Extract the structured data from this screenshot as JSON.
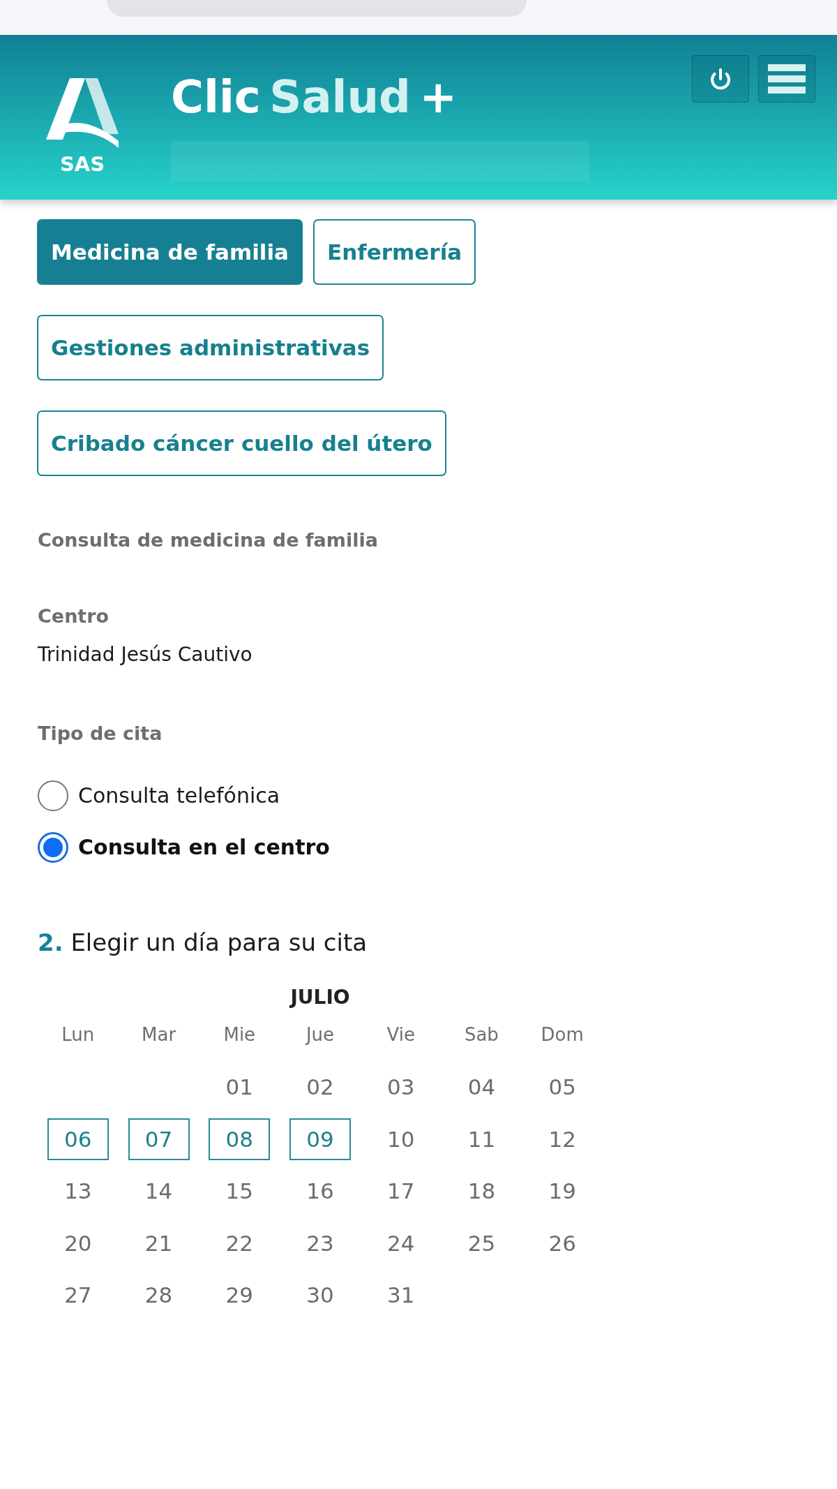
{
  "header": {
    "logo_text": "SAS",
    "title_parts": [
      "Clic",
      "Salud",
      "+"
    ]
  },
  "tabs": [
    {
      "label": "Medicina de familia",
      "selected": true
    },
    {
      "label": "Enfermería",
      "selected": false
    },
    {
      "label": "Gestiones administrativas",
      "selected": false
    },
    {
      "label": "Cribado cáncer cuello del útero",
      "selected": false
    }
  ],
  "section_title": "Consulta de medicina de familia",
  "centro": {
    "label": "Centro",
    "value": "Trinidad Jesús Cautivo"
  },
  "tipo_de_cita": {
    "label": "Tipo de cita",
    "options": [
      {
        "label": "Consulta telefónica",
        "selected": false
      },
      {
        "label": "Consulta en el centro",
        "selected": true
      }
    ]
  },
  "step": {
    "number": "2.",
    "title": "Elegir un día para su cita"
  },
  "calendar": {
    "month": "JULIO",
    "weekdays": [
      "Lun",
      "Mar",
      "Mie",
      "Jue",
      "Vie",
      "Sab",
      "Dom"
    ],
    "weeks": [
      [
        {
          "kind": "blank"
        },
        {
          "kind": "blank"
        },
        {
          "kind": "day",
          "day": "01",
          "available": false
        },
        {
          "kind": "day",
          "day": "02",
          "available": false
        },
        {
          "kind": "day",
          "day": "03",
          "available": false
        },
        {
          "kind": "day",
          "day": "04",
          "available": false
        },
        {
          "kind": "day",
          "day": "05",
          "available": false
        }
      ],
      [
        {
          "kind": "day",
          "day": "06",
          "available": true
        },
        {
          "kind": "day",
          "day": "07",
          "available": true
        },
        {
          "kind": "day",
          "day": "08",
          "available": true
        },
        {
          "kind": "day",
          "day": "09",
          "available": true
        },
        {
          "kind": "day",
          "day": "10",
          "available": false
        },
        {
          "kind": "day",
          "day": "11",
          "available": false
        },
        {
          "kind": "day",
          "day": "12",
          "available": false
        }
      ],
      [
        {
          "kind": "day",
          "day": "13",
          "available": false
        },
        {
          "kind": "day",
          "day": "14",
          "available": false
        },
        {
          "kind": "day",
          "day": "15",
          "available": false
        },
        {
          "kind": "day",
          "day": "16",
          "available": false
        },
        {
          "kind": "day",
          "day": "17",
          "available": false
        },
        {
          "kind": "day",
          "day": "18",
          "available": false
        },
        {
          "kind": "day",
          "day": "19",
          "available": false
        }
      ],
      [
        {
          "kind": "day",
          "day": "20",
          "available": false
        },
        {
          "kind": "day",
          "day": "21",
          "available": false
        },
        {
          "kind": "day",
          "day": "22",
          "available": false
        },
        {
          "kind": "day",
          "day": "23",
          "available": false
        },
        {
          "kind": "day",
          "day": "24",
          "available": false
        },
        {
          "kind": "day",
          "day": "25",
          "available": false
        },
        {
          "kind": "day",
          "day": "26",
          "available": false
        }
      ],
      [
        {
          "kind": "day",
          "day": "27",
          "available": false
        },
        {
          "kind": "day",
          "day": "28",
          "available": false
        },
        {
          "kind": "day",
          "day": "29",
          "available": false
        },
        {
          "kind": "day",
          "day": "30",
          "available": false
        },
        {
          "kind": "day",
          "day": "31",
          "available": false
        }
      ]
    ]
  }
}
